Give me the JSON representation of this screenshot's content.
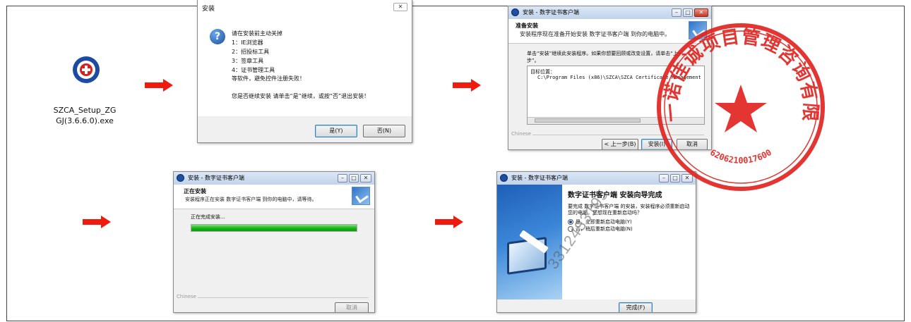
{
  "installer_file": {
    "name_line1": "SZCA_Setup_ZG",
    "name_line2": "GJ(3.6.6.0).exe",
    "icon": "szca-logo-icon"
  },
  "dialog_warning": {
    "title": "安装",
    "close_label": "✕",
    "icon": "question-icon",
    "intro": "请在安装前主动关掉",
    "items": [
      "1：IE浏览器",
      "2：招投标工具",
      "3：签章工具",
      "4：证书管理工具"
    ],
    "note": "等软件，避免控件注册失败！",
    "prompt": "您是否继续安装 请单击“是”继续，或按“否”退出安装！",
    "yes_label": "是(Y)",
    "no_label": "否(N)"
  },
  "dialog_ready": {
    "title": "安装 - 数字证书客户端",
    "heading": "准备安装",
    "subheading": "安装程序现在准备开始安装 数字证书客户端 到你的电脑中。",
    "instruction_line1": "单击“安装”继续此安装程序。如果你想要回顾或改变设置，请单击“上一",
    "instruction_line2": "步”。",
    "dest_label": "目标位置：",
    "dest_path": "C:\\Program Files (x86)\\SZCA\\SZCA Certificate Management",
    "brand": "Chinese",
    "back_label": "< 上一步(B)",
    "install_label": "安装(I)",
    "cancel_label": "取消"
  },
  "dialog_progress": {
    "title": "安装 - 数字证书客户端",
    "heading": "正在安装",
    "subheading": "安装程序正在安装 数字证书客户端 到你的电脑中，请等待。",
    "status": "正在完成安装...",
    "progress": 1.0,
    "brand": "Chinese",
    "cancel_label": "取消"
  },
  "dialog_finish": {
    "title": "安装 - 数字证书客户端",
    "heading": "数字证书客户端 安装向导完成",
    "body_line1": "要完成 数字证书客户端 的安装，安装程序必须重新启动",
    "body_line2": "您的电脑。您想现在重新启动吗？",
    "opt_yes": "是，立即重新启动电脑(Y)",
    "opt_no": "否，稍后重新启动电脑(N)",
    "finish_label": "完成(F)"
  },
  "seal": {
    "text": "甘肃一诺佳诚项目管理咨询有限公司",
    "number": "6206210017600",
    "color": "#e0201c"
  },
  "watermark": {
    "text": "3312433195"
  },
  "colors": {
    "arrow": "#f01a0f",
    "progress": "#1ec81e"
  }
}
